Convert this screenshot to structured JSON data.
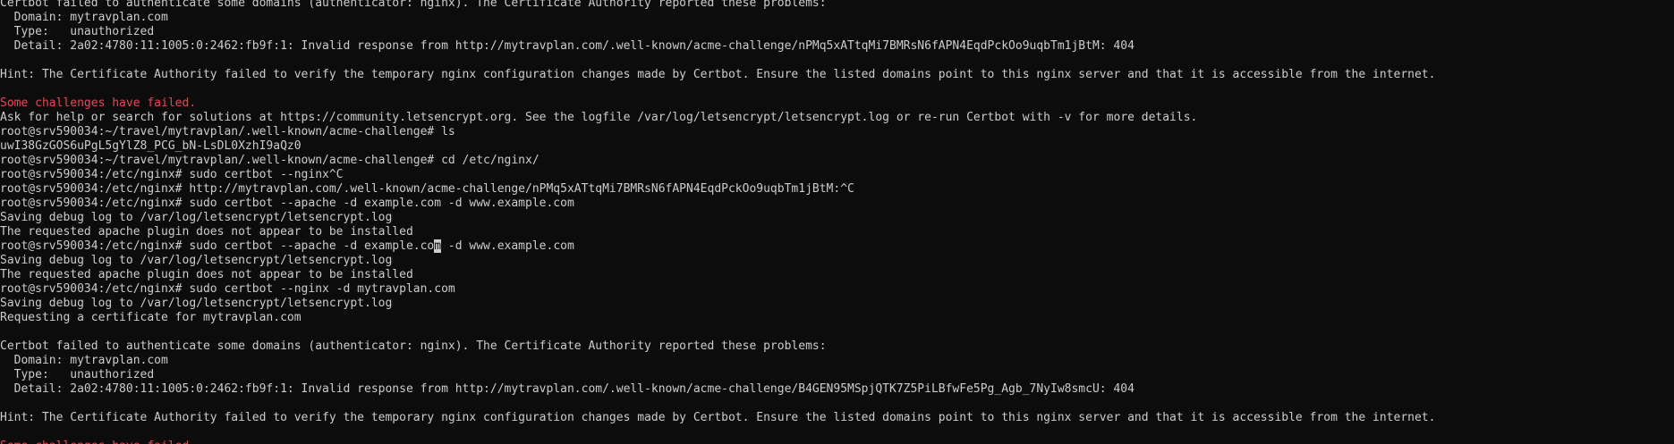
{
  "colors": {
    "background": "#0c0c0c",
    "foreground": "#cccccc",
    "error": "#e74856"
  },
  "lines": [
    {
      "text": "Certbot failed to authenticate some domains (authenticator: nginx). The Certificate Authority reported these problems:",
      "type": "output"
    },
    {
      "text": "  Domain: mytravplan.com",
      "type": "output"
    },
    {
      "text": "  Type:   unauthorized",
      "type": "output"
    },
    {
      "text": "  Detail: 2a02:4780:11:1005:0:2462:fb9f:1: Invalid response from http://mytravplan.com/.well-known/acme-challenge/nPMq5xATtqMi7BMRsN6fAPN4EqdPckOo9uqbTm1jBtM: 404",
      "type": "output"
    },
    {
      "text": "",
      "type": "blank"
    },
    {
      "text": "Hint: The Certificate Authority failed to verify the temporary nginx configuration changes made by Certbot. Ensure the listed domains point to this nginx server and that it is accessible from the internet.",
      "type": "output"
    },
    {
      "text": "",
      "type": "blank"
    },
    {
      "text": "Some challenges have failed.",
      "type": "error"
    },
    {
      "text": "Ask for help or search for solutions at https://community.letsencrypt.org. See the logfile /var/log/letsencrypt/letsencrypt.log or re-run Certbot with -v for more details.",
      "type": "output"
    },
    {
      "text": "root@srv590034:~/travel/mytravplan/.well-known/acme-challenge# ls",
      "type": "prompt"
    },
    {
      "text": "uwI38GzGOS6uPgL5gYlZ8_PCG_bN-LsDL0XzhI9aQz0",
      "type": "output"
    },
    {
      "text": "root@srv590034:~/travel/mytravplan/.well-known/acme-challenge# cd /etc/nginx/",
      "type": "prompt"
    },
    {
      "text": "root@srv590034:/etc/nginx# sudo certbot --nginx^C",
      "type": "prompt"
    },
    {
      "text": "root@srv590034:/etc/nginx# http://mytravplan.com/.well-known/acme-challenge/nPMq5xATtqMi7BMRsN6fAPN4EqdPckOo9uqbTm1jBtM:^C",
      "type": "prompt"
    },
    {
      "text": "root@srv590034:/etc/nginx# sudo certbot --apache -d example.com -d www.example.com",
      "type": "prompt"
    },
    {
      "text": "Saving debug log to /var/log/letsencrypt/letsencrypt.log",
      "type": "output"
    },
    {
      "text": "The requested apache plugin does not appear to be installed",
      "type": "output"
    },
    {
      "text": "root@srv590034:/etc/nginx# sudo certbot --apache -d example.com -d www.example.com",
      "type": "prompt",
      "cursor": 62
    },
    {
      "text": "Saving debug log to /var/log/letsencrypt/letsencrypt.log",
      "type": "output"
    },
    {
      "text": "The requested apache plugin does not appear to be installed",
      "type": "output"
    },
    {
      "text": "root@srv590034:/etc/nginx# sudo certbot --nginx -d mytravplan.com",
      "type": "prompt"
    },
    {
      "text": "Saving debug log to /var/log/letsencrypt/letsencrypt.log",
      "type": "output"
    },
    {
      "text": "Requesting a certificate for mytravplan.com",
      "type": "output"
    },
    {
      "text": "",
      "type": "blank"
    },
    {
      "text": "Certbot failed to authenticate some domains (authenticator: nginx). The Certificate Authority reported these problems:",
      "type": "output"
    },
    {
      "text": "  Domain: mytravplan.com",
      "type": "output"
    },
    {
      "text": "  Type:   unauthorized",
      "type": "output"
    },
    {
      "text": "  Detail: 2a02:4780:11:1005:0:2462:fb9f:1: Invalid response from http://mytravplan.com/.well-known/acme-challenge/B4GEN95MSpjQTK7Z5PiLBfwFe5Pg_Agb_7NyIw8smcU: 404",
      "type": "output"
    },
    {
      "text": "",
      "type": "blank"
    },
    {
      "text": "Hint: The Certificate Authority failed to verify the temporary nginx configuration changes made by Certbot. Ensure the listed domains point to this nginx server and that it is accessible from the internet.",
      "type": "output"
    },
    {
      "text": "",
      "type": "blank"
    },
    {
      "text": "Some challenges have failed.",
      "type": "error"
    }
  ]
}
